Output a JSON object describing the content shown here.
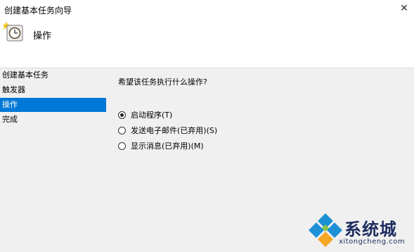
{
  "window": {
    "title": "创建基本任务向导",
    "close_glyph": "✕"
  },
  "header": {
    "title": "操作",
    "icon": "task-clock-icon"
  },
  "sidebar": {
    "items": [
      {
        "label": "创建基本任务"
      },
      {
        "label": "触发器"
      },
      {
        "label": "操作",
        "active": true
      },
      {
        "label": "完成"
      }
    ]
  },
  "content": {
    "prompt": "希望该任务执行什么操作?",
    "options": [
      {
        "label": "启动程序(T)",
        "checked": true
      },
      {
        "label": "发送电子邮件(已弃用)(S)",
        "checked": false
      },
      {
        "label": "显示消息(已弃用)(M)",
        "checked": false
      }
    ]
  },
  "watermark": {
    "brand": "系统城",
    "url": "xitongcheng.com"
  },
  "colors": {
    "accent": "#0078d7",
    "logo": "#1d2c5e"
  }
}
